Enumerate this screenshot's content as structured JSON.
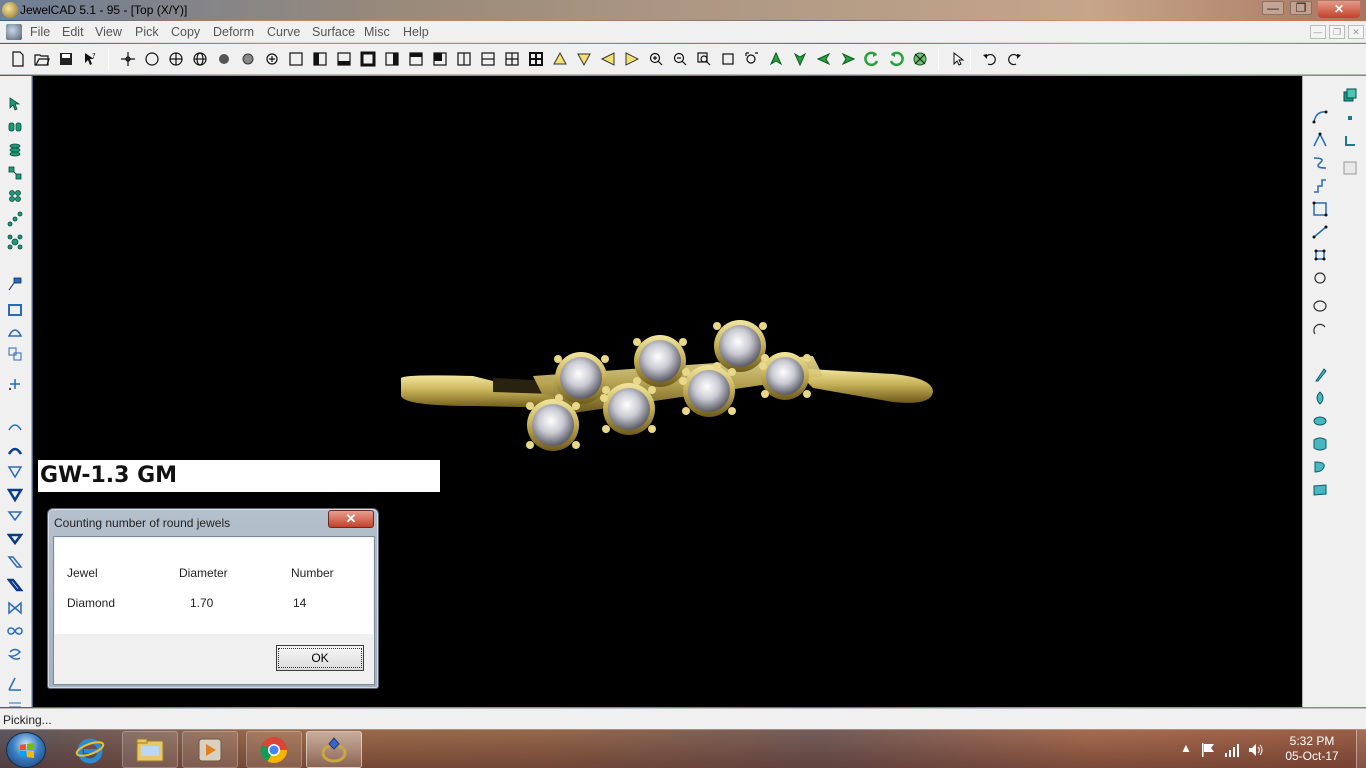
{
  "window": {
    "title": "JewelCAD 5.1 - 95 - [Top (X/Y)]",
    "min_glyph": "—",
    "max_glyph": "❐",
    "close_glyph": "✕"
  },
  "menu": {
    "items": [
      "File",
      "Edit",
      "View",
      "Pick",
      "Copy",
      "Deform",
      "Curve",
      "Surface",
      "Misc",
      "Help"
    ],
    "mdi_min": "—",
    "mdi_max": "❐",
    "mdi_close": "✕"
  },
  "toolbar": {
    "icons": [
      "new-file-icon",
      "open-folder-icon",
      "save-icon",
      "help-pointer-icon",
      "crosshair-icon",
      "circle-outline-icon",
      "circle-cross-icon",
      "globe-grid-icon",
      "sphere-solid-icon",
      "sphere-shaded-icon",
      "rotate-view-icon",
      "view-single-icon",
      "view-left-half-icon",
      "view-bottom-half-icon",
      "view-frame-icon",
      "view-right-half-icon",
      "view-top-half-icon",
      "view-corner-icon",
      "view-vsplit-icon",
      "view-hsplit-icon",
      "view-quad-icon",
      "view-quad-bold-icon",
      "arrow-up-triangle-icon",
      "arrow-down-triangle-icon",
      "arrow-left-triangle-icon",
      "arrow-right-triangle-icon",
      "zoom-in-icon",
      "zoom-out-icon",
      "zoom-window-icon",
      "zoom-box-icon",
      "zoom-fit-icon",
      "rotate-up-icon",
      "rotate-down-icon",
      "rotate-left-icon",
      "rotate-right-icon",
      "rotate-ccw-icon",
      "rotate-cw-icon",
      "render-icon",
      "select-arrow-icon",
      "undo-icon",
      "redo-icon"
    ]
  },
  "left_palette": {
    "icons": [
      "pick-select-icon",
      "pick-group-icon",
      "pick-stack-icon",
      "pick-chain-icon",
      "pick-cluster-icon",
      "pick-line-icon",
      "pick-network-icon",
      "label-icon",
      "rectangle-frame-icon",
      "hemisphere-icon",
      "copy-scale-icon",
      "point-add-icon",
      "arc-icon",
      "arc-bold-icon",
      "triangle-down-icon",
      "triangle-down-bold-icon",
      "triangle-outline-icon",
      "triangle-filled-icon",
      "parallelogram-icon",
      "parallelogram-bold-icon",
      "bowtie-icon",
      "infinity-icon",
      "spiral-icon",
      "angle-icon",
      "grid-icon"
    ]
  },
  "right_palette": {
    "icons": [
      "curve-bezier-icon",
      "curve-peak-icon",
      "curve-s-icon",
      "curve-step-icon",
      "curve-box-icon",
      "line-diagonal-icon",
      "curve-node-icon",
      "circle-small-icon",
      "ellipse-icon",
      "arc-open-icon",
      "surface-extrude-icon",
      "surface-revolve-icon",
      "surface-sweep-icon",
      "surface-loft-icon",
      "surface-twist-icon",
      "surface-patch-icon",
      "window-stack-icon",
      "dot-icon",
      "corner-icon",
      "panel-icon"
    ]
  },
  "viewport": {
    "weight_label": "GW-1.3 GM",
    "background": "#000000",
    "gold_color": "#c9b45a",
    "diamond_color": "#d9d9e0"
  },
  "dialog": {
    "title": "Counting number of round jewels",
    "close_glyph": "✕",
    "columns": [
      "Jewel",
      "Diameter",
      "Number"
    ],
    "rows": [
      {
        "jewel": "Diamond",
        "diameter": "1.70",
        "number": "14"
      }
    ],
    "ok_label": "OK"
  },
  "status": {
    "text": "Picking..."
  },
  "taskbar": {
    "apps": [
      "internet-explorer-icon",
      "file-explorer-icon",
      "media-player-icon",
      "chrome-icon",
      "jewelcad-icon"
    ],
    "tray": {
      "arrow": "▲",
      "time": "5:32 PM",
      "date": "05-Oct-17"
    }
  }
}
